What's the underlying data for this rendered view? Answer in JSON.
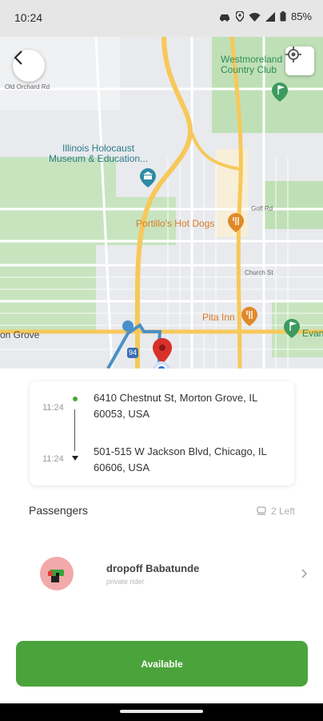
{
  "status_bar": {
    "time": "10:24",
    "battery": "85%",
    "icons": [
      "car-icon",
      "location-icon",
      "wifi-icon",
      "signal-icon",
      "battery-icon"
    ]
  },
  "map": {
    "labels": {
      "westmoreland": "Westmoreland\nCountry Club",
      "holocaust_museum": "Illinois Holocaust\nMuseum & Education...",
      "portillos": "Portillo's Hot Dogs",
      "pita_inn": "Pita Inn",
      "morton_grove": "on Grove",
      "evan": "Evan",
      "golf_rd": "Golf Rd",
      "church_st": "Church St",
      "old_orchard_rd": "Old Orchard Rd",
      "highway": "94"
    },
    "icons": [
      "back-icon",
      "locate-icon",
      "destination-pin-icon",
      "current-location-icon",
      "restaurant-icon",
      "golf-icon",
      "museum-icon"
    ]
  },
  "route": {
    "pickup_time": "11:24",
    "pickup_address": "6410 Chestnut St, Morton Grove, IL 60053, USA",
    "dropoff_time": "11:24",
    "dropoff_address": "501-515 W Jackson Blvd, Chicago, IL 60606, USA"
  },
  "passengers": {
    "title": "Passengers",
    "seats_left": "2 Left",
    "items": [
      {
        "name": "dropoff Babatunde",
        "type": "private rider"
      }
    ]
  },
  "action": {
    "label": "Available"
  },
  "colors": {
    "accent_green": "#4aa43b",
    "map_road_yellow": "#f7c85a",
    "route_blue": "#4a90c8",
    "pin_red": "#d9302c"
  }
}
